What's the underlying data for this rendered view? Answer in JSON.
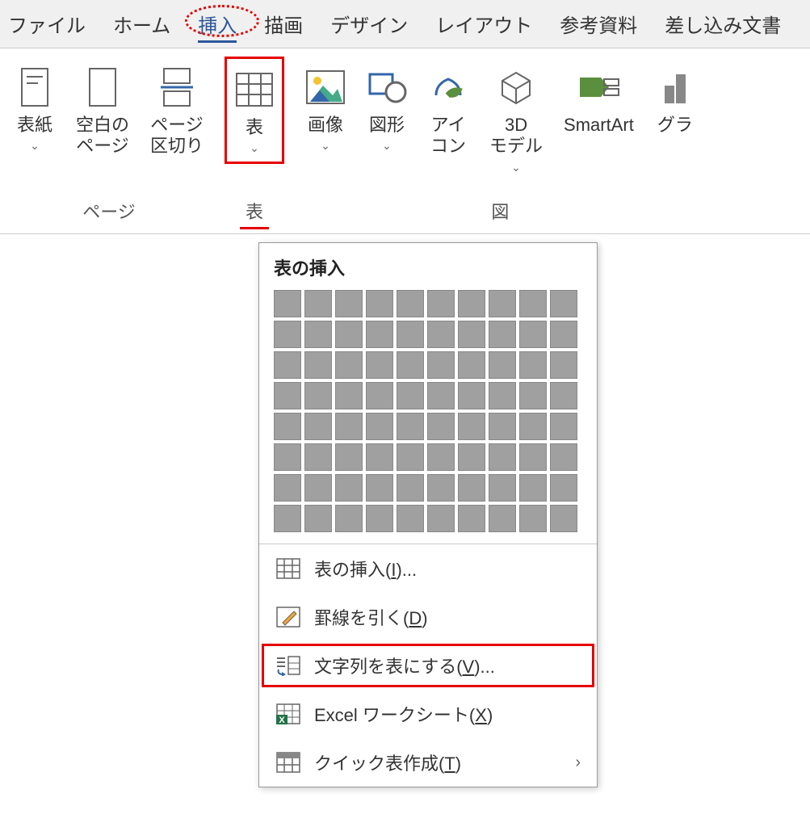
{
  "menubar": {
    "items": [
      {
        "label": "ファイル"
      },
      {
        "label": "ホーム"
      },
      {
        "label": "挿入",
        "active": true
      },
      {
        "label": "描画"
      },
      {
        "label": "デザイン"
      },
      {
        "label": "レイアウト"
      },
      {
        "label": "参考資料"
      },
      {
        "label": "差し込み文書"
      }
    ]
  },
  "ribbon": {
    "groups": [
      {
        "name": "pages",
        "label": "ページ",
        "buttons": [
          {
            "name": "cover-page",
            "label": "表紙",
            "icon": "cover-page-icon",
            "caret": true
          },
          {
            "name": "blank-page",
            "label": "空白の\nページ",
            "icon": "blank-page-icon",
            "caret": false
          },
          {
            "name": "page-break",
            "label": "ページ\n区切り",
            "icon": "page-break-icon",
            "caret": false
          }
        ]
      },
      {
        "name": "tables",
        "label": "表",
        "highlighted": true,
        "buttons": [
          {
            "name": "table",
            "label": "表",
            "icon": "table-icon",
            "caret": true,
            "boxed": true
          }
        ]
      },
      {
        "name": "illustrations",
        "label": "図",
        "buttons": [
          {
            "name": "pictures",
            "label": "画像",
            "icon": "picture-icon",
            "caret": true
          },
          {
            "name": "shapes",
            "label": "図形",
            "icon": "shapes-icon",
            "caret": true
          },
          {
            "name": "icons",
            "label": "アイ\nコン",
            "icon": "icons-icon",
            "caret": false
          },
          {
            "name": "3d-models",
            "label": "3D\nモデル",
            "icon": "3d-model-icon",
            "caret": true
          },
          {
            "name": "smartart",
            "label": "SmartArt",
            "icon": "smartart-icon",
            "caret": false
          },
          {
            "name": "chart",
            "label": "グラ",
            "icon": "chart-icon",
            "caret": false
          }
        ]
      }
    ]
  },
  "dropdown": {
    "title": "表の挿入",
    "grid": {
      "cols": 10,
      "rows": 8
    },
    "options": [
      {
        "name": "insert-table",
        "label_pre": "表の挿入(",
        "hotkey": "I",
        "label_post": ")...",
        "icon": "insert-table-icon"
      },
      {
        "name": "draw-table",
        "label_pre": "罫線を引く(",
        "hotkey": "D",
        "label_post": ")",
        "icon": "draw-table-icon"
      },
      {
        "name": "convert-text",
        "label_pre": "文字列を表にする(",
        "hotkey": "V",
        "label_post": ")...",
        "icon": "convert-text-icon",
        "boxed": true
      },
      {
        "name": "excel-sheet",
        "label_pre": "Excel ワークシート(",
        "hotkey": "X",
        "label_post": ")",
        "icon": "excel-icon"
      },
      {
        "name": "quick-tables",
        "label_pre": "クイック表作成(",
        "hotkey": "T",
        "label_post": ")",
        "icon": "quick-tables-icon",
        "submenu": true
      }
    ]
  }
}
